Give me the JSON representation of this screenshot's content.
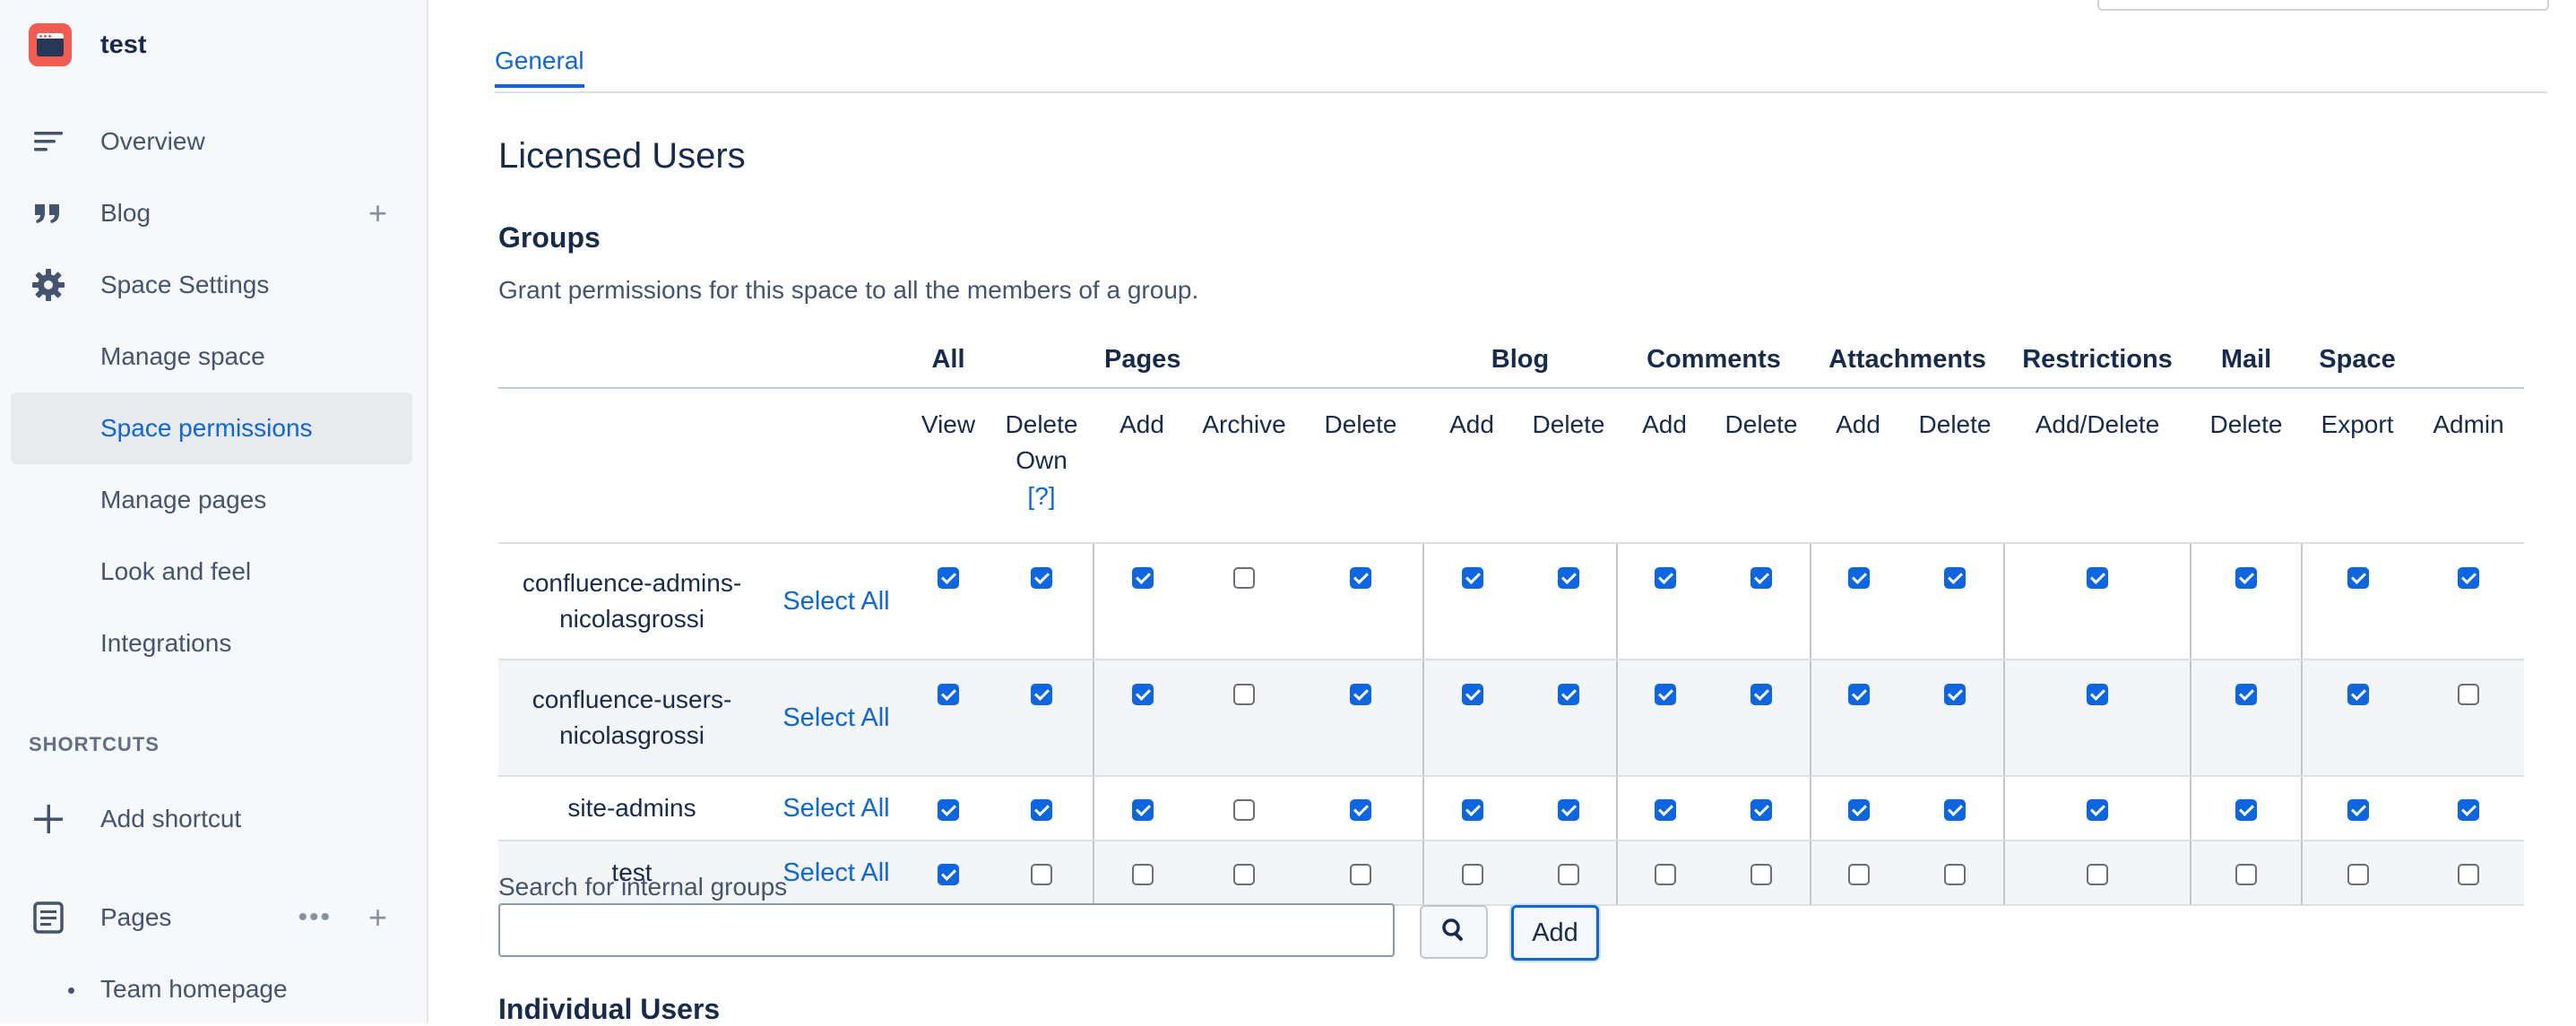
{
  "space": {
    "name": "test"
  },
  "sidebar": {
    "overview": "Overview",
    "blog": "Blog",
    "space_settings": "Space Settings",
    "sub_items": [
      "Manage space",
      "Space permissions",
      "Manage pages",
      "Look and feel",
      "Integrations"
    ],
    "active_item": "Space permissions",
    "shortcuts_heading": "SHORTCUTS",
    "add_shortcut": "Add shortcut",
    "pages": "Pages",
    "team_homepage": "Team homepage"
  },
  "tabs": {
    "general": "General"
  },
  "headings": {
    "licensed_users": "Licensed Users",
    "groups": "Groups",
    "groups_desc": "Grant permissions for this space to all the members of a group.",
    "individual_users": "Individual Users"
  },
  "table": {
    "categories": [
      "All",
      "Pages",
      "Blog",
      "Comments",
      "Attachments",
      "Restrictions",
      "Mail",
      "Space"
    ],
    "sub": {
      "view": "View",
      "delete_own_1": "Delete",
      "delete_own_2": "Own",
      "help": "[?]",
      "pages_add": "Add",
      "pages_archive": "Archive",
      "pages_delete": "Delete",
      "blog_add": "Add",
      "blog_delete": "Delete",
      "comments_add": "Add",
      "comments_delete": "Delete",
      "attachments_add": "Add",
      "attachments_delete": "Delete",
      "restrictions": "Add/Delete",
      "mail_delete": "Delete",
      "space_export": "Export",
      "space_admin": "Admin"
    },
    "select_all": "Select All",
    "groups": [
      {
        "name_1": "confluence-admins-",
        "name_2": "nicolasgrossi",
        "perms": [
          true,
          true,
          true,
          false,
          true,
          true,
          true,
          true,
          true,
          true,
          true,
          true,
          true,
          true,
          true
        ]
      },
      {
        "name_1": "confluence-users-",
        "name_2": "nicolasgrossi",
        "perms": [
          true,
          true,
          true,
          false,
          true,
          true,
          true,
          true,
          true,
          true,
          true,
          true,
          true,
          true,
          false
        ]
      },
      {
        "name_1": "site-admins",
        "name_2": "",
        "perms": [
          true,
          true,
          true,
          false,
          true,
          true,
          true,
          true,
          true,
          true,
          true,
          true,
          true,
          true,
          true
        ]
      },
      {
        "name_1": "test",
        "name_2": "",
        "perms": [
          true,
          false,
          false,
          false,
          false,
          false,
          false,
          false,
          false,
          false,
          false,
          false,
          false,
          false,
          false
        ]
      }
    ]
  },
  "search": {
    "label": "Search for internal groups",
    "value": "",
    "add": "Add"
  },
  "colors": {
    "accent": "#0c66e4",
    "logo": "#f15b50"
  }
}
